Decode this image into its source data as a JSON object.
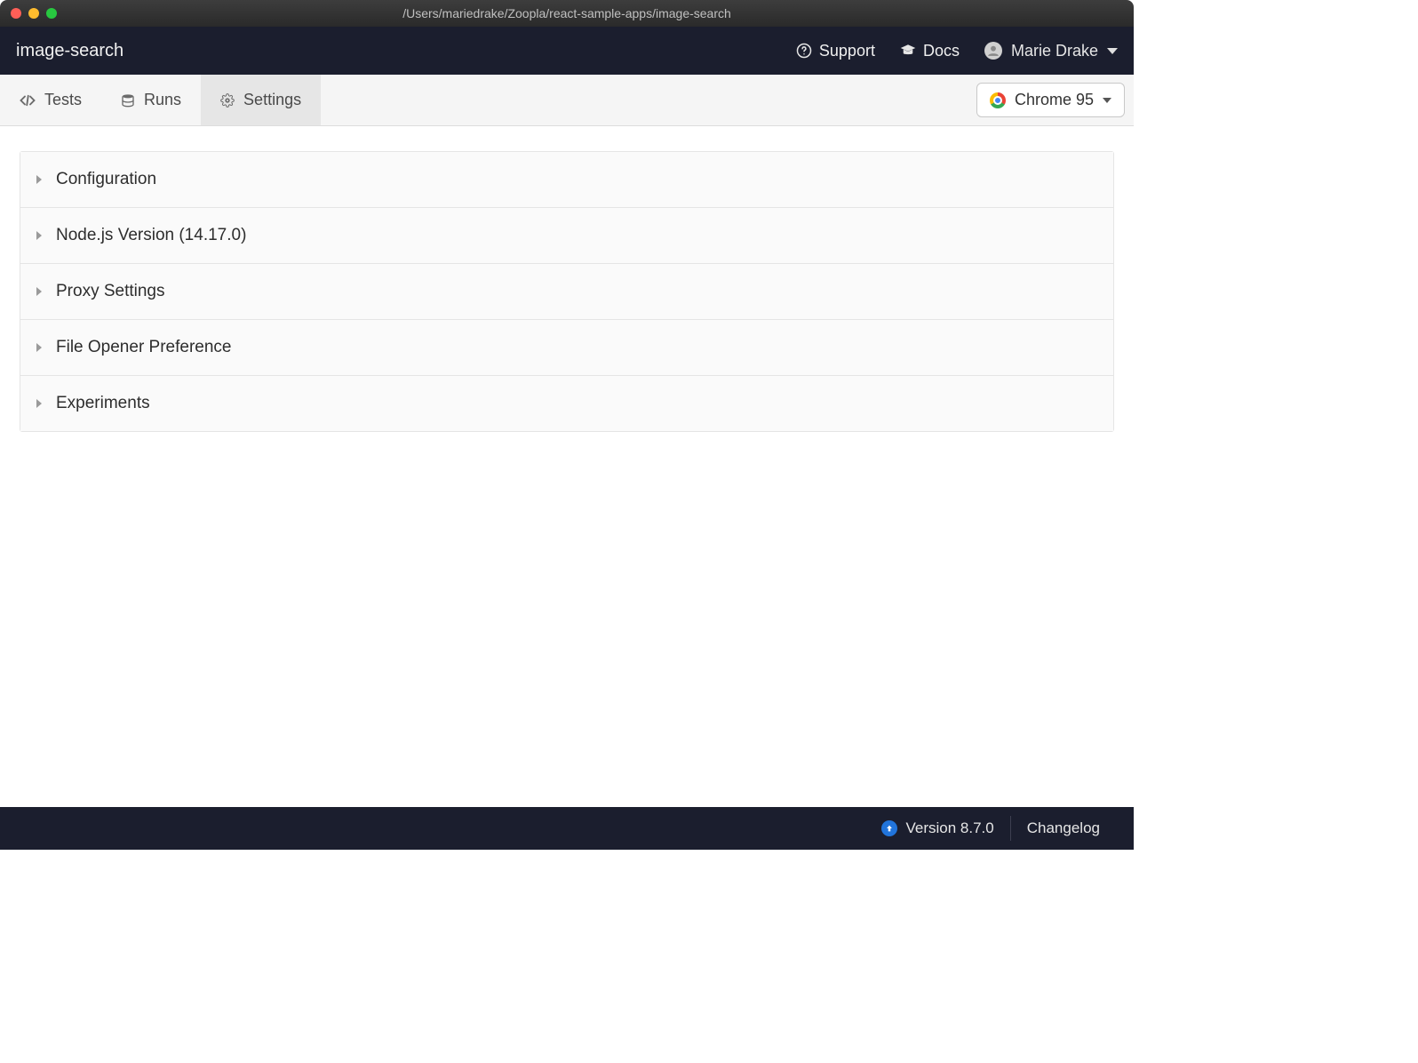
{
  "window": {
    "title": "/Users/mariedrake/Zoopla/react-sample-apps/image-search"
  },
  "header": {
    "project_name": "image-search",
    "support_label": "Support",
    "docs_label": "Docs",
    "user_name": "Marie Drake"
  },
  "tabs": {
    "tests_label": "Tests",
    "runs_label": "Runs",
    "settings_label": "Settings"
  },
  "browser": {
    "selected_label": "Chrome 95"
  },
  "settings_sections": [
    {
      "label": "Configuration"
    },
    {
      "label": "Node.js Version (14.17.0)"
    },
    {
      "label": "Proxy Settings"
    },
    {
      "label": "File Opener Preference"
    },
    {
      "label": "Experiments"
    }
  ],
  "footer": {
    "version_label": "Version 8.7.0",
    "changelog_label": "Changelog"
  }
}
